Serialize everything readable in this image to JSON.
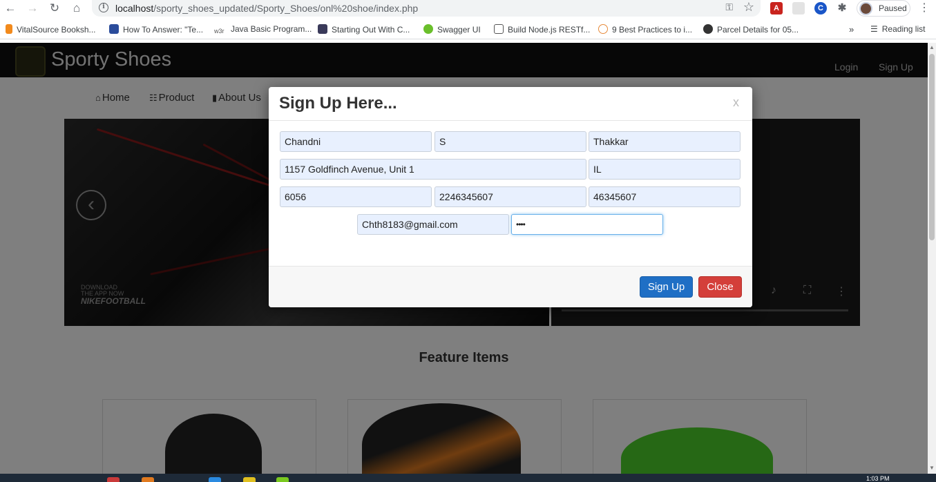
{
  "browser": {
    "url_host": "localhost",
    "url_path": "/sporty_shoes_updated/Sporty_Shoes/onl%20shoe/index.php",
    "profile_label": "Paused",
    "bookmarks": [
      "VitalSource Booksh...",
      "How To Answer: \"Te...",
      "Java Basic Program...",
      "Starting Out With C...",
      "Swagger UI",
      "Build Node.js RESTf...",
      "9 Best Practices to i...",
      "Parcel Details for 05..."
    ],
    "reading_list": "Reading list",
    "more_bookmarks": "»"
  },
  "site": {
    "brand": "Sporty Shoes",
    "header_links": [
      "Login",
      "Sign Up"
    ],
    "nav": [
      {
        "label": "Home",
        "icon": "home-icon"
      },
      {
        "label": "Product",
        "icon": "list-icon"
      },
      {
        "label": "About Us",
        "icon": "bookmark-icon"
      }
    ],
    "carousel": {
      "promo_line1": "DOWNLOAD",
      "promo_line2": "THE APP NOW",
      "promo_brand": "NIKEFOOTBALL",
      "prev_icon": "chevron-left-icon"
    },
    "section_title": "Feature Items"
  },
  "modal": {
    "title": "Sign Up Here...",
    "close_glyph": "x",
    "fields": {
      "first_name": "Chandni",
      "middle_name": "S",
      "last_name": "Thakkar",
      "address": "1157 Goldfinch Avenue, Unit 1",
      "state": "IL",
      "zip": "6056",
      "phone": "2246345607",
      "alt_phone": "46345607",
      "email": "Chth8183@gmail.com",
      "password": "••••"
    },
    "buttons": {
      "submit": "Sign Up",
      "close": "Close"
    },
    "colors": {
      "primary": "#1f6fc5",
      "danger": "#d43f3a"
    }
  },
  "taskbar": {
    "clock": "1:03 PM"
  }
}
